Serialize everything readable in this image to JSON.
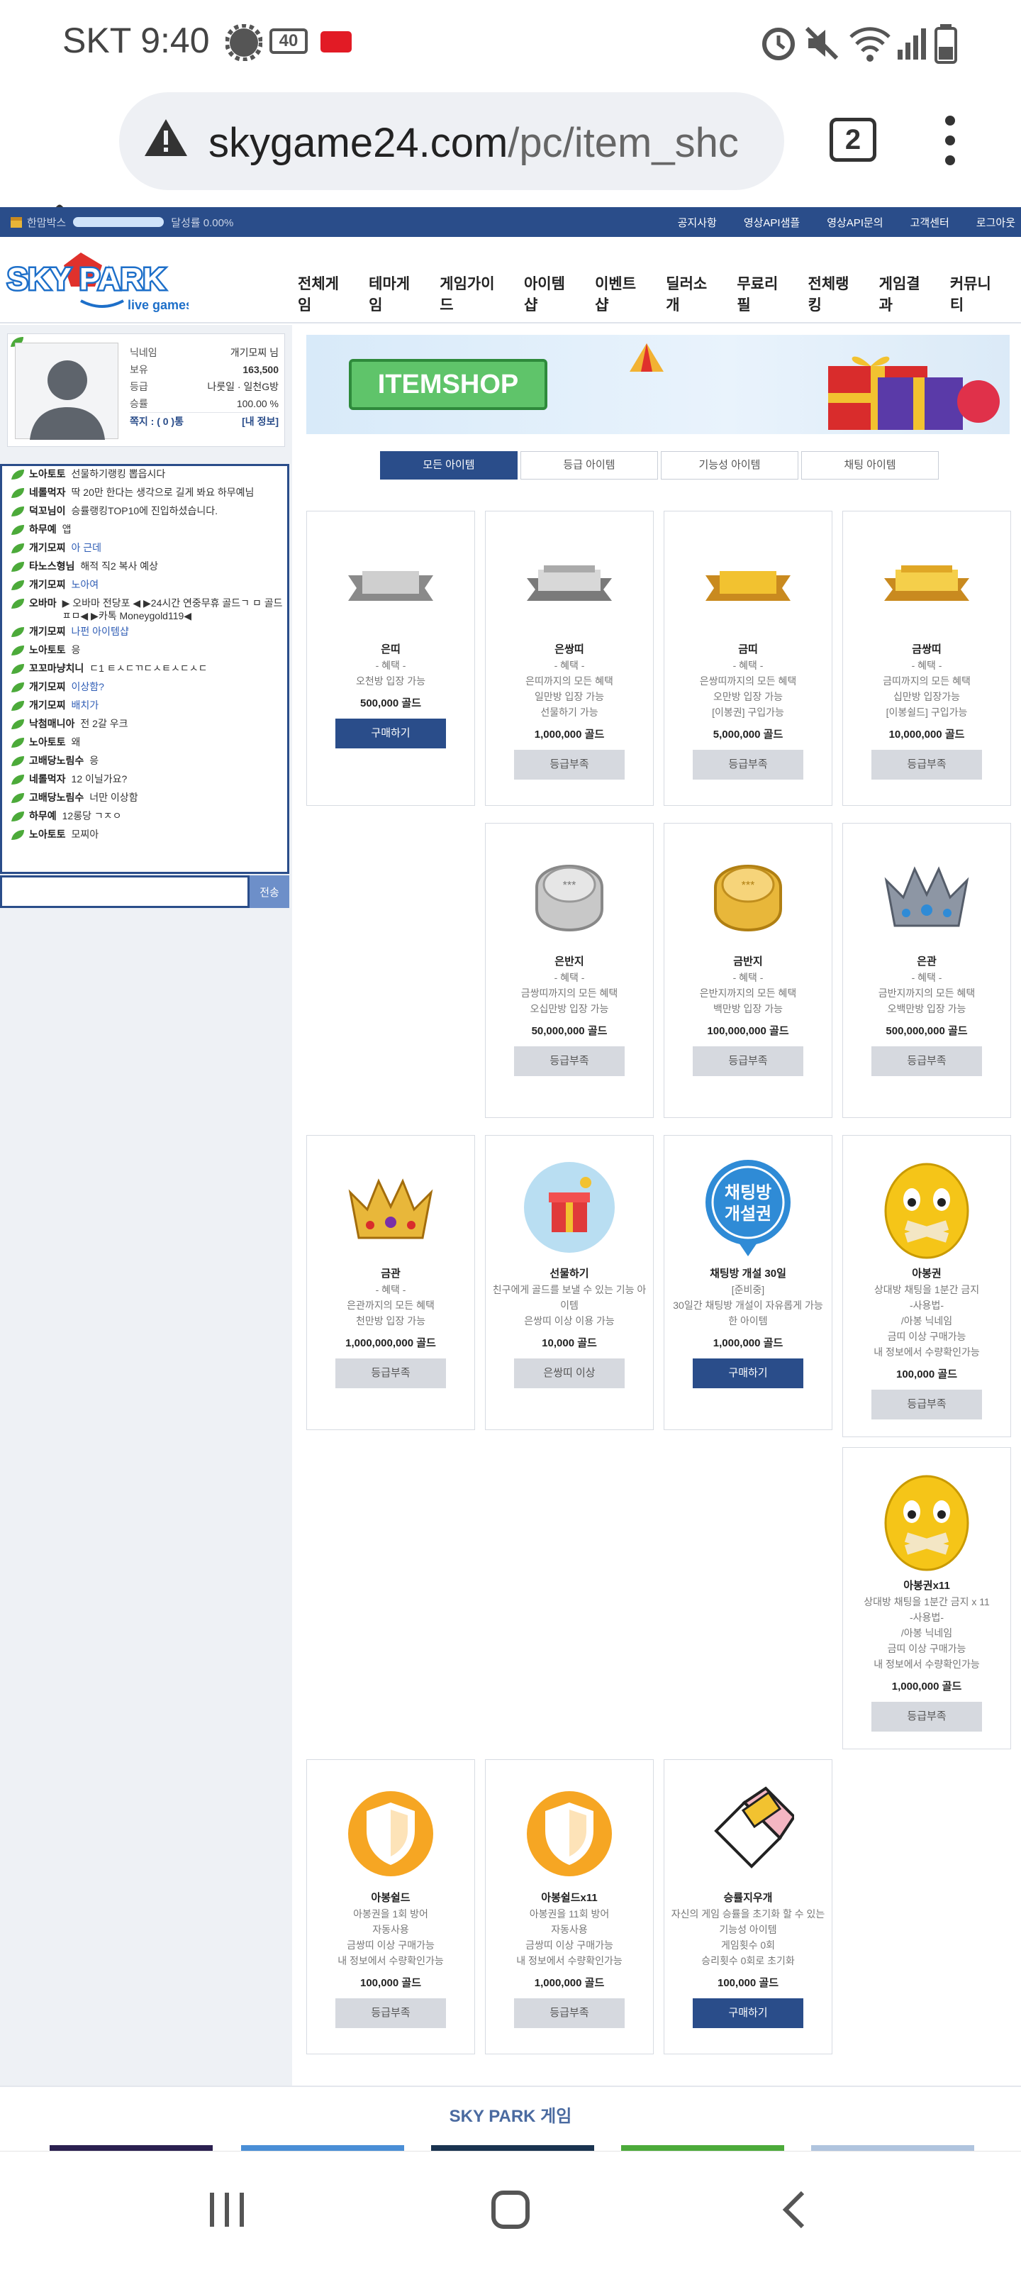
{
  "status": {
    "time": "SKT 9:40",
    "battery_badge": "40"
  },
  "browser": {
    "url_host": "skygame24.com",
    "url_path": "/pc/item_shc",
    "tab_count": "2"
  },
  "topnav": {
    "left_label": "한맘박스",
    "achievement": "달성률 0.00%",
    "links": [
      "공지사항",
      "영상API샘플",
      "영상API문의",
      "고객센터",
      "로그아웃"
    ]
  },
  "logo": {
    "line1": "SKY PARK",
    "line2": "live games"
  },
  "menu": [
    "전체게임",
    "테마게임",
    "게임가이드",
    "아이템샵",
    "이벤트샵",
    "딜러소개",
    "무료리필",
    "전체랭킹",
    "게임결과",
    "커뮤니티"
  ],
  "profile": {
    "rows": [
      {
        "label": "닉네임",
        "value": "개기모찌 님"
      },
      {
        "label": "보유",
        "value": "163,500"
      },
      {
        "label": "등급",
        "value": "나룻일 · 일천G방"
      },
      {
        "label": "승률",
        "value": "100.00 %"
      }
    ],
    "mail": "쪽지 : ( 0 )통",
    "myinfo": "[내 정보]"
  },
  "chat": {
    "lines": [
      {
        "nick": "노아토토",
        "msg": "선물하기랭킹 뽑읍시다",
        "blue": false
      },
      {
        "nick": "네롤먹자",
        "msg": "딱 20만 한다는 생각으로 길게 봐요 하무예님",
        "blue": false
      },
      {
        "nick": "덕꼬님이",
        "msg": "승률랭킹TOP10에 진입하셨습니다.",
        "blue": false
      },
      {
        "nick": "하무예",
        "msg": "앱",
        "blue": false
      },
      {
        "nick": "개기모찌",
        "msg": "아 근데",
        "blue": true
      },
      {
        "nick": "타노스형님",
        "msg": "해적 직2 복사 예상",
        "blue": false
      },
      {
        "nick": "개기모찌",
        "msg": "노아여",
        "blue": true
      },
      {
        "nick": "오바마",
        "msg": "▶ 오바마 전당포 ◀ ▶24시간 연중무휴 골드ㄱ ㅁ 골드ㅍㅁ◀ ▶카톡 Moneygold119◀",
        "blue": false
      },
      {
        "nick": "개기모찌",
        "msg": "나펀 아이템샵",
        "blue": true
      },
      {
        "nick": "노아토토",
        "msg": "응",
        "blue": false
      },
      {
        "nick": "꼬꼬마냥치니",
        "msg": "ㄷ1 ㅌㅅㄷㄲㄷㅅㅌㅅㄷㅅㄷ",
        "blue": false
      },
      {
        "nick": "개기모찌",
        "msg": "이상함?",
        "blue": true
      },
      {
        "nick": "개기모찌",
        "msg": "배치가",
        "blue": true
      },
      {
        "nick": "낙첨매니아",
        "msg": "전 2갈 우크",
        "blue": false
      },
      {
        "nick": "노아토토",
        "msg": "왜",
        "blue": false
      },
      {
        "nick": "고배당노림수",
        "msg": "응",
        "blue": false
      },
      {
        "nick": "네롤먹자",
        "msg": "12 이닐가요?",
        "blue": false
      },
      {
        "nick": "고배당노림수",
        "msg": "너만 이상함",
        "blue": false
      },
      {
        "nick": "하무예",
        "msg": "12롱당 ㄱㅈㅇ",
        "blue": false
      },
      {
        "nick": "노아토토",
        "msg": "모찌아",
        "blue": false
      }
    ],
    "send": "전송"
  },
  "banner": {
    "label": "ITEMSHOP"
  },
  "tabs": [
    "모든 아이템",
    "등급 아이템",
    "기능성 아이템",
    "채팅 아이템"
  ],
  "items": [
    {
      "name": "은띠",
      "desc": "- 혜택 -\n오천방 입장 가능",
      "price": "500,000 골드",
      "button": "구매하기",
      "buy": true,
      "icon": "silver-ribbon-icon"
    },
    {
      "name": "은쌍띠",
      "desc": "- 혜택 -\n은띠까지의 모든 혜택\n일만방 입장 가능\n선물하기 가능",
      "price": "1,000,000 골드",
      "button": "등급부족",
      "buy": false,
      "icon": "double-silver-ribbon-icon"
    },
    {
      "name": "금띠",
      "desc": "- 혜택 -\n은쌍띠까지의 모든 혜택\n오만방 입장 가능\n[이봉권] 구입가능",
      "price": "5,000,000 골드",
      "button": "등급부족",
      "buy": false,
      "icon": "gold-ribbon-icon"
    },
    {
      "name": "금쌍띠",
      "desc": "- 혜택 -\n금띠까지의 모든 혜택\n십만방 입장가능\n[이봉쉴드] 구입가능",
      "price": "10,000,000 골드",
      "button": "등급부족",
      "buy": false,
      "icon": "double-gold-ribbon-icon"
    },
    {
      "name": "은반지",
      "desc": "- 혜택 -\n금쌍띠까지의 모든 혜택\n오십만방 입장 가능",
      "price": "50,000,000 골드",
      "button": "등급부족",
      "buy": false,
      "icon": "silver-ring-icon"
    },
    {
      "name": "금반지",
      "desc": "- 혜택 -\n은반지까지의 모든 혜택\n백만방 입장 가능",
      "price": "100,000,000 골드",
      "button": "등급부족",
      "buy": false,
      "icon": "gold-ring-icon"
    },
    {
      "name": "은관",
      "desc": "- 혜택 -\n금반지까지의 모든 혜택\n오백만방 입장 가능",
      "price": "500,000,000 골드",
      "button": "등급부족",
      "buy": false,
      "icon": "silver-crown-icon"
    },
    {
      "name": "금관",
      "desc": "- 혜택 -\n은관까지의 모든 혜택\n천만방 입장 가능",
      "price": "1,000,000,000 골드",
      "button": "등급부족",
      "buy": false,
      "icon": "gold-crown-icon"
    },
    {
      "name": "선물하기",
      "desc": "친구에게 골드를 보낼 수 있는 기능 아이템\n은쌍띠 이상 이용 가능",
      "price": "10,000 골드",
      "button": "은쌍띠 이상",
      "buy": false,
      "icon": "gift-icon"
    },
    {
      "name": "채팅방 개설 30일",
      "desc": "[준비중]\n30일간 채팅방 개설이 자유롭게 가능한 아이템",
      "price": "1,000,000 골드",
      "button": "구매하기",
      "buy": true,
      "icon": "chat-room-icon"
    },
    {
      "name": "아봉권",
      "desc": "상대방 채팅을 1분간 금지\n-사용법-\n/아봉 닉네임\n금띠 이상 구매가능\n내 정보에서 수량확인가능",
      "price": "100,000 골드",
      "button": "등급부족",
      "buy": false,
      "icon": "smiley-tape-icon"
    },
    {
      "name": "아봉권x11",
      "desc": "상대방 채팅을 1분간 금지 x 11\n-사용법-\n/아봉 닉네임\n금띠 이상 구매가능\n내 정보에서 수량확인가능",
      "price": "1,000,000 골드",
      "button": "등급부족",
      "buy": false,
      "icon": "smiley-tape-icon"
    },
    {
      "name": "아봉쉴드",
      "desc": "아봉권을 1회 방어\n자동사용\n금쌍띠 이상 구매가능\n내 정보에서 수량확인가능",
      "price": "100,000 골드",
      "button": "등급부족",
      "buy": false,
      "icon": "shield-icon"
    },
    {
      "name": "아봉쉴드x11",
      "desc": "아봉권을 11회 방어\n자동사용\n금쌍띠 이상 구매가능\n내 정보에서 수량확인가능",
      "price": "1,000,000 골드",
      "button": "등급부족",
      "buy": false,
      "icon": "shield-icon"
    },
    {
      "name": "승률지우개",
      "desc": "자신의 게임 승률을 초기화 할 수 있는 기능성 아이템\n게임횟수 0회\n승리횟수 0회로 초기화",
      "price": "100,000 골드",
      "button": "구매하기",
      "buy": true,
      "icon": "eraser-icon"
    }
  ],
  "footer": {
    "title": "SKY PARK 게임"
  },
  "colors": {
    "navy": "#2a4d8a",
    "grade_btn": "#d6d9df",
    "link_blue": "#2f5db5"
  }
}
